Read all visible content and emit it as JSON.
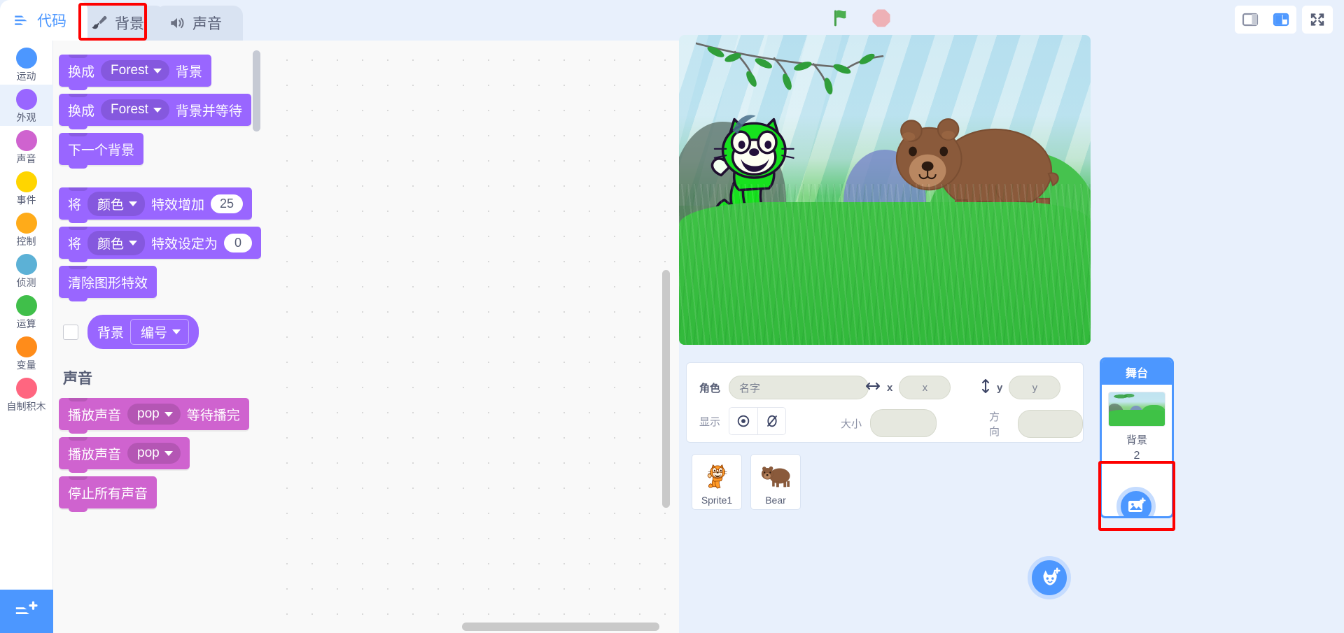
{
  "tabs": [
    {
      "label": "代码",
      "icon": "code-icon",
      "active": true
    },
    {
      "label": "背景",
      "icon": "paintbrush-icon",
      "active": false,
      "highlighted": true
    },
    {
      "label": "声音",
      "icon": "speaker-icon",
      "active": false
    }
  ],
  "run_controls": {
    "green_flag": "green-flag-icon",
    "stop": "stop-icon"
  },
  "stage_controls": {
    "small_stage": "small-stage-icon",
    "large_stage": "large-stage-icon",
    "fullscreen": "fullscreen-icon"
  },
  "categories": [
    {
      "label": "运动",
      "color": "#4c97ff",
      "selected": false
    },
    {
      "label": "外观",
      "color": "#9966ff",
      "selected": true
    },
    {
      "label": "声音",
      "color": "#cf63cf",
      "selected": false
    },
    {
      "label": "事件",
      "color": "#ffd500",
      "selected": false
    },
    {
      "label": "控制",
      "color": "#ffab19",
      "selected": false
    },
    {
      "label": "侦测",
      "color": "#5cb1d6",
      "selected": false
    },
    {
      "label": "运算",
      "color": "#40bf4a",
      "selected": false
    },
    {
      "label": "变量",
      "color": "#ff8c1a",
      "selected": false
    },
    {
      "label": "自制积木",
      "color": "#ff6680",
      "selected": false
    }
  ],
  "extension_button": "add-extension-icon",
  "palette": {
    "looks_blocks": [
      {
        "id": "switch-backdrop",
        "pre": "换成",
        "dropdown": "Forest",
        "post": "背景"
      },
      {
        "id": "switch-backdrop-wait",
        "pre": "换成",
        "dropdown": "Forest",
        "post": "背景并等待"
      },
      {
        "id": "next-backdrop",
        "pre": "下一个背景",
        "dropdown": "",
        "post": ""
      },
      {
        "id": "change-effect",
        "pre": "将",
        "dropdown": "颜色",
        "post": "特效增加",
        "value": "25"
      },
      {
        "id": "set-effect",
        "pre": "将",
        "dropdown": "颜色",
        "post": "特效设定为",
        "value": "0"
      },
      {
        "id": "clear-effects",
        "pre": "清除图形特效",
        "dropdown": "",
        "post": ""
      }
    ],
    "reporter": {
      "checkbox": false,
      "label": "背景",
      "dropdown": "编号"
    },
    "sound_section_label": "声音",
    "sound_blocks": [
      {
        "id": "play-sound-until-done",
        "pre": "播放声音",
        "dropdown": "pop",
        "post": "等待播完"
      },
      {
        "id": "play-sound",
        "pre": "播放声音",
        "dropdown": "pop",
        "post": ""
      },
      {
        "id": "stop-all-sounds",
        "pre": "停止所有声音",
        "dropdown": "",
        "post": ""
      }
    ]
  },
  "workspace": {
    "zoom_in": "zoom-in-icon",
    "zoom_out": "zoom-out-icon",
    "zoom_reset": "zoom-reset-icon"
  },
  "sprite_info": {
    "name_label": "角色",
    "name_value": "名字",
    "x_label": "x",
    "x_value": "x",
    "y_label": "y",
    "y_value": "y",
    "show_label": "显示",
    "size_label": "大小",
    "size_value": "",
    "direction_label": "方向",
    "direction_value": "",
    "show_icon": "eye-visible-icon",
    "hide_icon": "eye-hidden-icon"
  },
  "sprites": [
    {
      "name": "Sprite1",
      "icon": "scratch-cat-icon",
      "selected": false
    },
    {
      "name": "Bear",
      "icon": "bear-icon",
      "selected": false
    }
  ],
  "add_sprite_button": "add-sprite-icon",
  "stage_selector": {
    "title": "舞台",
    "backdrops_label": "背景",
    "backdrop_count": "2",
    "add_backdrop_button": "add-backdrop-icon",
    "highlighted": true
  },
  "colors": {
    "accent": "#4c97ff",
    "looks": "#9966ff",
    "sound": "#cf63cf",
    "highlight": "#fe0000",
    "text": "#575e75",
    "panel_bg": "#e8f0fc"
  }
}
